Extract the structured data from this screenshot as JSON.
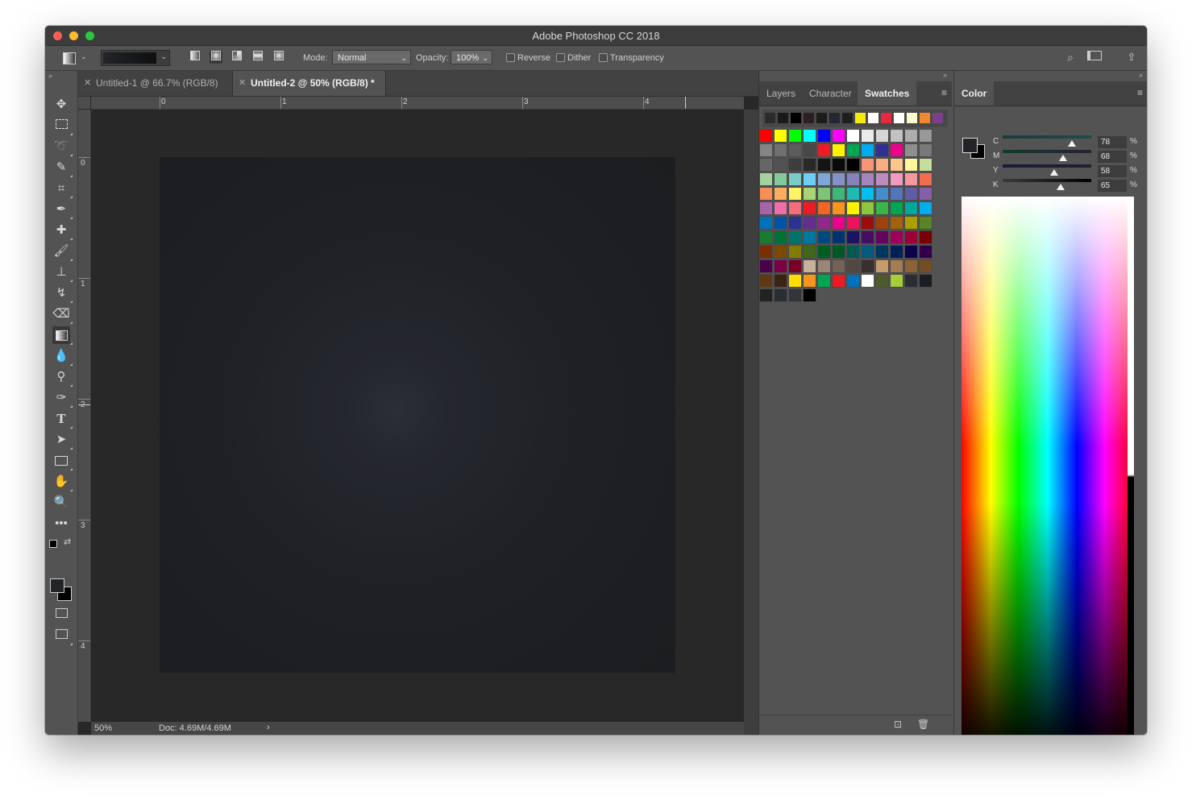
{
  "window": {
    "title": "Adobe Photoshop CC 2018"
  },
  "options": {
    "mode_label": "Mode:",
    "mode_value": "Normal",
    "opacity_label": "Opacity:",
    "opacity_value": "100%",
    "reverse_label": "Reverse",
    "dither_label": "Dither",
    "transparency_label": "Transparency"
  },
  "tabs": [
    {
      "label": "Untitled-1 @ 66.7% (RGB/8)",
      "active": false
    },
    {
      "label": "Untitled-2 @ 50% (RGB/8) *",
      "active": true
    }
  ],
  "ruler": {
    "h_labels": [
      "0",
      "1",
      "2",
      "3",
      "4"
    ],
    "v_labels": [
      "0",
      "1",
      "2",
      "3",
      "4"
    ]
  },
  "status": {
    "zoom": "50%",
    "doc": "Doc: 4.69M/4.69M",
    "arrow": "›"
  },
  "panel_tabs": {
    "layers": "Layers",
    "character": "Character",
    "swatches": "Swatches"
  },
  "swatches": {
    "recent": [
      "#2b2b2b",
      "#1a1a1a",
      "#000000",
      "#2a2024",
      "#1c1c1c",
      "#222831",
      "#1e1e1e",
      "#f6ea0b",
      "#ffffff",
      "#e8283c",
      "#ffffff",
      "#fffacd",
      "#f08a2c",
      "#7b3f8c"
    ],
    "rows": [
      [
        "#ff0000",
        "#ffff00",
        "#00ff00",
        "#00ffff",
        "#0000ff",
        "#ff00ff",
        "#ffffff",
        "#ebebeb",
        "#d6d6d6",
        "#c2c2c2",
        "#adadad",
        "#999999"
      ],
      [
        "#858585",
        "#707070",
        "#5c5c5c",
        "#474747",
        "#ed1c24",
        "#fff200",
        "#00a651",
        "#00aeef",
        "#2e3192",
        "#ec008c",
        "#8f8f8f",
        "#7a7a7a"
      ],
      [
        "#666666",
        "#525252",
        "#3d3d3d",
        "#292929",
        "#141414",
        "#0a0a0a",
        "#000000",
        "#f69679",
        "#f9ad81",
        "#fdc68a",
        "#fff799",
        "#c4df9b"
      ],
      [
        "#a3d39c",
        "#82ca9c",
        "#7accc8",
        "#6dcff6",
        "#7da7d9",
        "#8393ca",
        "#8781bd",
        "#a187be",
        "#bd8cbf",
        "#f49ac2",
        "#f6989d",
        "#f26c4f"
      ],
      [
        "#f68e56",
        "#fbaf5d",
        "#fff467",
        "#acd373",
        "#7cc576",
        "#3cb878",
        "#1cbbb4",
        "#00bff3",
        "#448ccb",
        "#5674b9",
        "#605ca8",
        "#855fa8"
      ],
      [
        "#a864a8",
        "#f06ea9",
        "#f26d7d",
        "#ed1c24",
        "#f26522",
        "#f7941d",
        "#fff200",
        "#8dc73f",
        "#39b54a",
        "#00a651",
        "#00a99d",
        "#00aeef"
      ],
      [
        "#0072bc",
        "#0054a6",
        "#2e3192",
        "#662d91",
        "#92278f",
        "#ec008c",
        "#ed145b",
        "#9e0b0f",
        "#a0410d",
        "#a36209",
        "#aba000",
        "#598527"
      ],
      [
        "#197b30",
        "#007236",
        "#00746b",
        "#0076a3",
        "#004a80",
        "#003471",
        "#1b1464",
        "#440e62",
        "#630460",
        "#9e005d",
        "#9e0039",
        "#790000"
      ],
      [
        "#7b2e00",
        "#7d4900",
        "#827b00",
        "#406618",
        "#005e20",
        "#005826",
        "#005952",
        "#005b7f",
        "#003663",
        "#002157",
        "#0d004c",
        "#32004b"
      ],
      [
        "#4b0049",
        "#7b0046",
        "#7a0026",
        "#c7b299",
        "#998675",
        "#736357",
        "#534741",
        "#37302d",
        "#c69c6d",
        "#a67c52",
        "#8c6239",
        "#754c24"
      ],
      [
        "#603913",
        "#3c2415",
        "#ffdd00",
        "#f7941d",
        "#00a651",
        "#ed1c24",
        "#0072bc",
        "#ffffff",
        "#4d5b2a",
        "#a6ce39",
        "#2b2d33",
        "#1c1d21"
      ],
      [
        "#222222",
        "#2a2e34",
        "#33353a",
        "#000000"
      ]
    ]
  },
  "color_panel": {
    "title": "Color",
    "channels": [
      {
        "label": "C",
        "value": "78",
        "unit": "%",
        "level": 0.78
      },
      {
        "label": "M",
        "value": "68",
        "unit": "%",
        "level": 0.68
      },
      {
        "label": "Y",
        "value": "58",
        "unit": "%",
        "level": 0.58
      },
      {
        "label": "K",
        "value": "65",
        "unit": "%",
        "level": 0.65
      }
    ],
    "foreground": "#222428",
    "background": "#000000"
  }
}
